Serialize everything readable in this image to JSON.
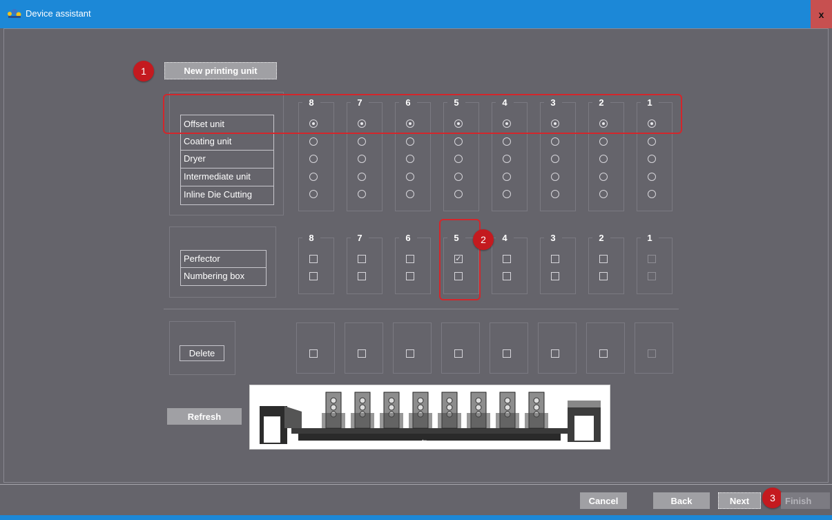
{
  "window": {
    "title": "Device assistant",
    "close_label": "x"
  },
  "icons": {
    "app": "device-assistant-icon",
    "close": "close-icon"
  },
  "buttons": {
    "new_unit": "New printing unit",
    "delete": "Delete",
    "refresh": "Refresh"
  },
  "markers": [
    "1",
    "2",
    "3"
  ],
  "columns": [
    "8",
    "7",
    "6",
    "5",
    "4",
    "3",
    "2",
    "1"
  ],
  "units": {
    "rows": [
      "Offset unit",
      "Coating unit",
      "Dryer",
      "Intermediate unit",
      "Inline Die Cutting"
    ],
    "selected_row": 0
  },
  "options": {
    "rows": [
      "Perfector",
      "Numbering box"
    ],
    "checked": [
      [
        false,
        false,
        false,
        true,
        false,
        false,
        false,
        false
      ],
      [
        false,
        false,
        false,
        false,
        false,
        false,
        false,
        false
      ]
    ],
    "disabled_columns": [
      "1"
    ]
  },
  "delete_checks": {
    "checked": [
      false,
      false,
      false,
      false,
      false,
      false,
      false,
      false
    ],
    "disabled_columns": [
      "1"
    ]
  },
  "machine": {
    "printing_unit_count": 8,
    "image": "printing-press-diagram"
  },
  "footer": {
    "cancel": "Cancel",
    "back": "Back",
    "next": "Next",
    "finish": "Finish"
  },
  "colors": {
    "titlebar": "#1c88d7",
    "background": "#65646b",
    "highlight": "#d3262b",
    "marker": "#c41a1f",
    "close": "#c75050"
  }
}
